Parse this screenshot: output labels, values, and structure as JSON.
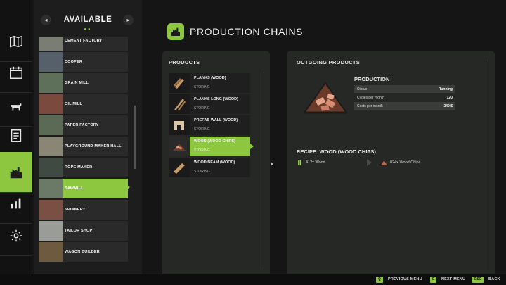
{
  "header": {
    "title": "PRODUCTION CHAINS"
  },
  "sidebar_list": {
    "title": "AVAILABLE",
    "prev_icon": "chevron-left-icon",
    "next_icon": "chevron-right-icon",
    "items": [
      {
        "label": "CEMENT FACTORY"
      },
      {
        "label": "COOPER"
      },
      {
        "label": "GRAIN MILL"
      },
      {
        "label": "OIL MILL"
      },
      {
        "label": "PAPER FACTORY"
      },
      {
        "label": "PLAYGROUND MAKER HALL"
      },
      {
        "label": "ROPE MAKER"
      },
      {
        "label": "SAWMILL",
        "selected": true
      },
      {
        "label": "SPINNERY"
      },
      {
        "label": "TAILOR SHOP"
      },
      {
        "label": "WAGON BUILDER"
      }
    ]
  },
  "nav_icons": [
    "map-icon",
    "calendar-icon",
    "cow-icon",
    "contract-icon",
    "production-icon",
    "stats-icon",
    "settings-icon"
  ],
  "products": {
    "label": "PRODUCTS",
    "items": [
      {
        "name": "PLANKS (WOOD)",
        "status": "STORING"
      },
      {
        "name": "PLANKS LONG (WOOD)",
        "status": "STORING"
      },
      {
        "name": "PREFAB WALL (WOOD)",
        "status": "STORING"
      },
      {
        "name": "WOOD (WOOD CHIPS)",
        "status": "STORING",
        "selected": true
      },
      {
        "name": "WOOD BEAM (WOOD)",
        "status": "STORING"
      }
    ]
  },
  "outgoing": {
    "label": "OUTGOING PRODUCTS",
    "production": {
      "title": "PRODUCTION",
      "rows": [
        {
          "key": "Status",
          "value": "Running"
        },
        {
          "key": "Cycles per month",
          "value": "120"
        },
        {
          "key": "Costs per month",
          "value": "240 $"
        }
      ]
    },
    "recipe": {
      "title": "RECIPE: WOOD (WOOD CHIPS)",
      "input": "412x Wood",
      "output": "824x Wood Chips"
    }
  },
  "footer": {
    "items": [
      {
        "key": "Q",
        "label": "PREVIOUS MENU"
      },
      {
        "key": "E",
        "label": "NEXT MENU"
      },
      {
        "key": "ESC",
        "label": "BACK"
      }
    ]
  },
  "colors": {
    "accent": "#8dc63f",
    "background": "#151515",
    "panel": "#262826"
  }
}
